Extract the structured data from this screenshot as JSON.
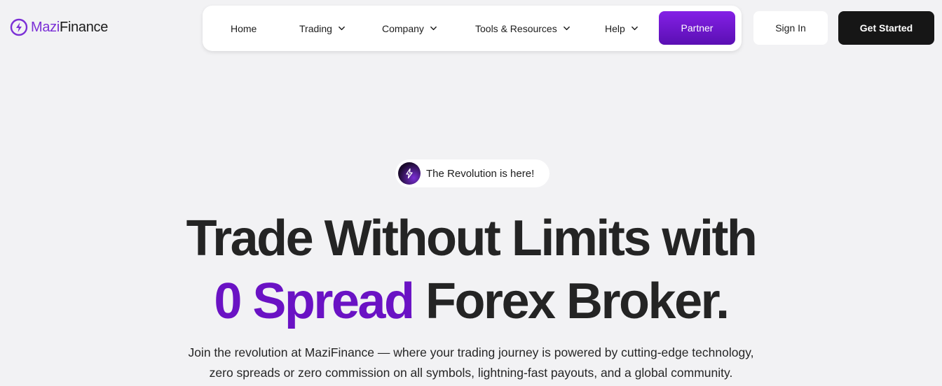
{
  "brand": {
    "name_part1": "Mazi",
    "name_part2": "Finance",
    "accent_color": "#7b2fd6"
  },
  "nav": {
    "items": [
      {
        "label": "Home",
        "has_dropdown": false
      },
      {
        "label": "Trading",
        "has_dropdown": true
      },
      {
        "label": "Company",
        "has_dropdown": true
      },
      {
        "label": "Tools & Resources",
        "has_dropdown": true
      },
      {
        "label": "Help",
        "has_dropdown": true
      }
    ],
    "partner_label": "Partner"
  },
  "auth": {
    "signin_label": "Sign In",
    "get_started_label": "Get Started"
  },
  "hero": {
    "badge_text": "The Revolution is here!",
    "badge_icon": "lightning-icon",
    "headline_line1": "Trade Without Limits with",
    "headline_highlight": "0 Spread",
    "headline_line2_rest": " Forex Broker.",
    "highlight_color": "#6a12c4",
    "subtext_line1": "Join the revolution at MaziFinance — where your trading journey is powered by cutting-edge technology,",
    "subtext_line2": "zero spreads or zero commission on all symbols, lightning-fast payouts, and a global community."
  }
}
